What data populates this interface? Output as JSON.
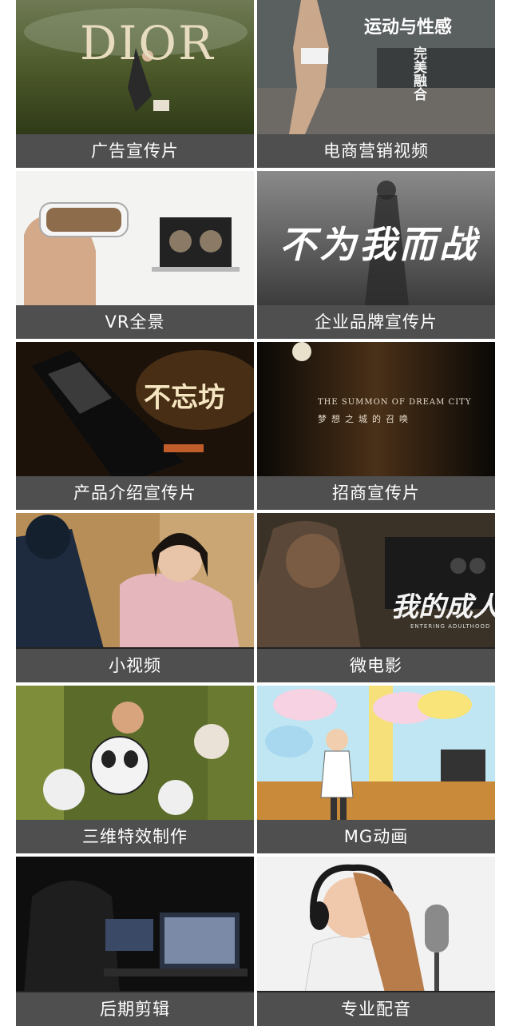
{
  "tiles": [
    {
      "label": "广告宣传片",
      "overlay": "DIOR"
    },
    {
      "label": "电商营销视频",
      "overlay": "运动与性感",
      "overlay2": "完美融合"
    },
    {
      "label": "VR全景"
    },
    {
      "label": "企业品牌宣传片",
      "overlay": "不为我而战"
    },
    {
      "label": "产品介绍宣传片",
      "overlay": "不忘坊"
    },
    {
      "label": "招商宣传片",
      "overlay": "THE SUMMON OF DREAM CITY",
      "overlay2": "梦想之城的召唤"
    },
    {
      "label": "小视频"
    },
    {
      "label": "微电影",
      "overlay": "我的成人",
      "overlay2": "ENTERING ADULTHOOD"
    },
    {
      "label": "三维特效制作"
    },
    {
      "label": "MG动画"
    },
    {
      "label": "后期剪辑"
    },
    {
      "label": "专业配音"
    }
  ],
  "colors": {
    "caption_bg": "#4f4f4f",
    "caption_text": "#ffffff"
  }
}
